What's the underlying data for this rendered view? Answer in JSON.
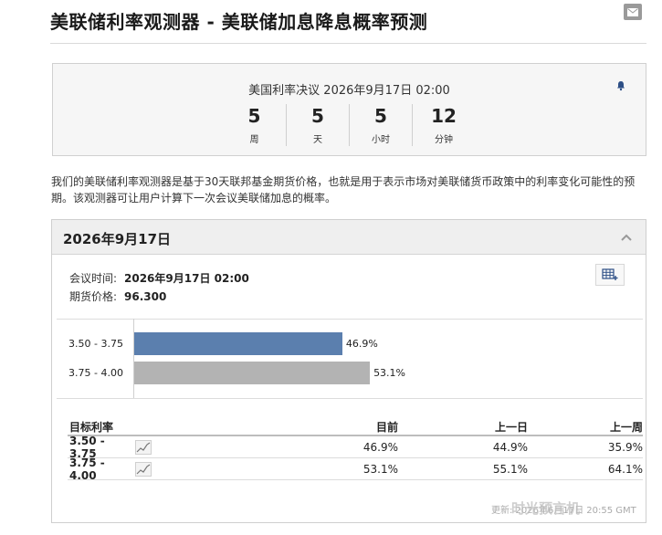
{
  "page": {
    "title": "美联储利率观测器 - 美联储加息降息概率预测"
  },
  "countdown": {
    "label": "美国利率决议 2026年9月17日 02:00",
    "units": [
      {
        "value": "5",
        "name": "周"
      },
      {
        "value": "5",
        "name": "天"
      },
      {
        "value": "5",
        "name": "小时"
      },
      {
        "value": "12",
        "name": "分钟"
      }
    ]
  },
  "description": "我们的美联储利率观测器是基于30天联邦基金期货价格，也就是用于表示市场对美联储货币政策中的利率变化可能性的预期。该观测器可让用户计算下一次会议美联储加息的概率。",
  "panel": {
    "date": "2026年9月17日",
    "meeting_label": "会议时间:",
    "meeting_value": "2026年9月17日 02:00",
    "futures_label": "期货价格:",
    "futures_value": "96.300"
  },
  "chart_data": {
    "type": "bar",
    "orientation": "horizontal",
    "categories": [
      "3.50 - 3.75",
      "3.75 - 4.00"
    ],
    "values": [
      46.9,
      53.1
    ],
    "value_labels": [
      "46.9%",
      "53.1%"
    ],
    "colors": [
      "#5b7fae",
      "#b3b3b3"
    ],
    "xlim": [
      0,
      100
    ]
  },
  "table": {
    "headers": [
      "目标利率",
      "目前",
      "上一日",
      "上一周"
    ],
    "rows": [
      {
        "rate": "3.50 - 3.75",
        "current": "46.9%",
        "prev_day": "44.9%",
        "prev_week": "35.9%"
      },
      {
        "rate": "3.75 - 4.00",
        "current": "53.1%",
        "prev_day": "55.1%",
        "prev_week": "64.1%"
      }
    ]
  },
  "footnote": "更新: 2026年6月17日 20:55 GMT",
  "watermark": "时光预言机"
}
